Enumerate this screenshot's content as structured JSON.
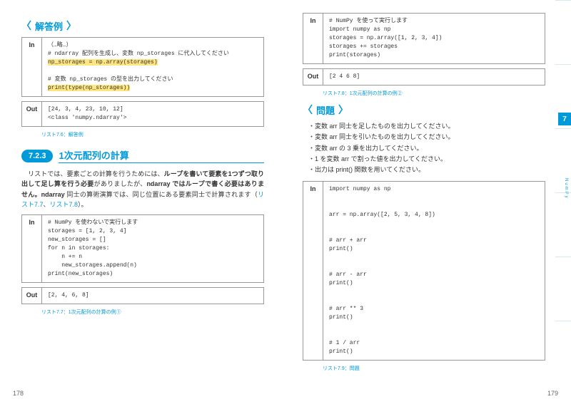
{
  "left": {
    "header1": "解答例",
    "code1": {
      "label": "In",
      "text": "（…略…）\n# ndarray 配列を生成し、変数 np_storages に代入してください\n<HL>np_storages = np.array(storages)</HL>\n\n# 変数 np_storages の型を出力してください\n<HL>print(type(np_storages))</HL>"
    },
    "code2": {
      "label": "Out",
      "text": "[24, 3, 4, 23, 10, 12]\n<class 'numpy.ndarray'>"
    },
    "caption1": "リスト7.6：解答例",
    "chapter": {
      "badge": "7.2.3",
      "title": "1次元配列の計算"
    },
    "para": "　リストでは、要素ごとの計算を行うためには、<b>ループを書いて要素を1つずつ取り出して足し算を行う必要</b>がありましたが、<b>ndarray ではループで書く必要はありません。ndarray</b> 同士の算術演算では、同じ位置にある要素同士で計算されます（<span class='link'>リスト7.7</span>、<span class='link'>リスト7.8</span>）。",
    "code3": {
      "label": "In",
      "text": "# NumPy を使わないで実行します\nstorages = [1, 2, 3, 4]\nnew_storages = []\nfor n in storages:\n    n += n\n    new_storages.append(n)\nprint(new_storages)"
    },
    "code4": {
      "label": "Out",
      "text": "[2, 4, 6, 8]"
    },
    "caption2": "リスト7.7：1次元配列の計算の例①",
    "pagenum": "178"
  },
  "right": {
    "code1": {
      "label": "In",
      "text": "# NumPy を使って実行します\nimport numpy as np\nstorages = np.array([1, 2, 3, 4])\nstorages += storages\nprint(storages)"
    },
    "code2": {
      "label": "Out",
      "text": "[2 4 6 8]"
    },
    "caption1": "リスト7.8：1次元配列の計算の例②",
    "header": "問題",
    "bullets": [
      "変数 arr 同士を足したものを出力してください。",
      "変数 arr 同士を引いたものを出力してください。",
      "変数 arr の 3 乗を出力してください。",
      "1 を変数 arr で割った値を出力してください。",
      "出力は print() 関数を用いてください。"
    ],
    "code3": {
      "label": "In",
      "text": "import numpy as np\n\n\narr = np.array([2, 5, 3, 4, 8])\n\n\n# arr + arr\nprint()\n\n\n# arr - arr\nprint()\n\n\n# arr ** 3\nprint()\n\n\n# 1 / arr\nprint()"
    },
    "caption2": "リスト7.9：問題",
    "pagenum": "179",
    "tab": "7",
    "side": "NumPy"
  }
}
